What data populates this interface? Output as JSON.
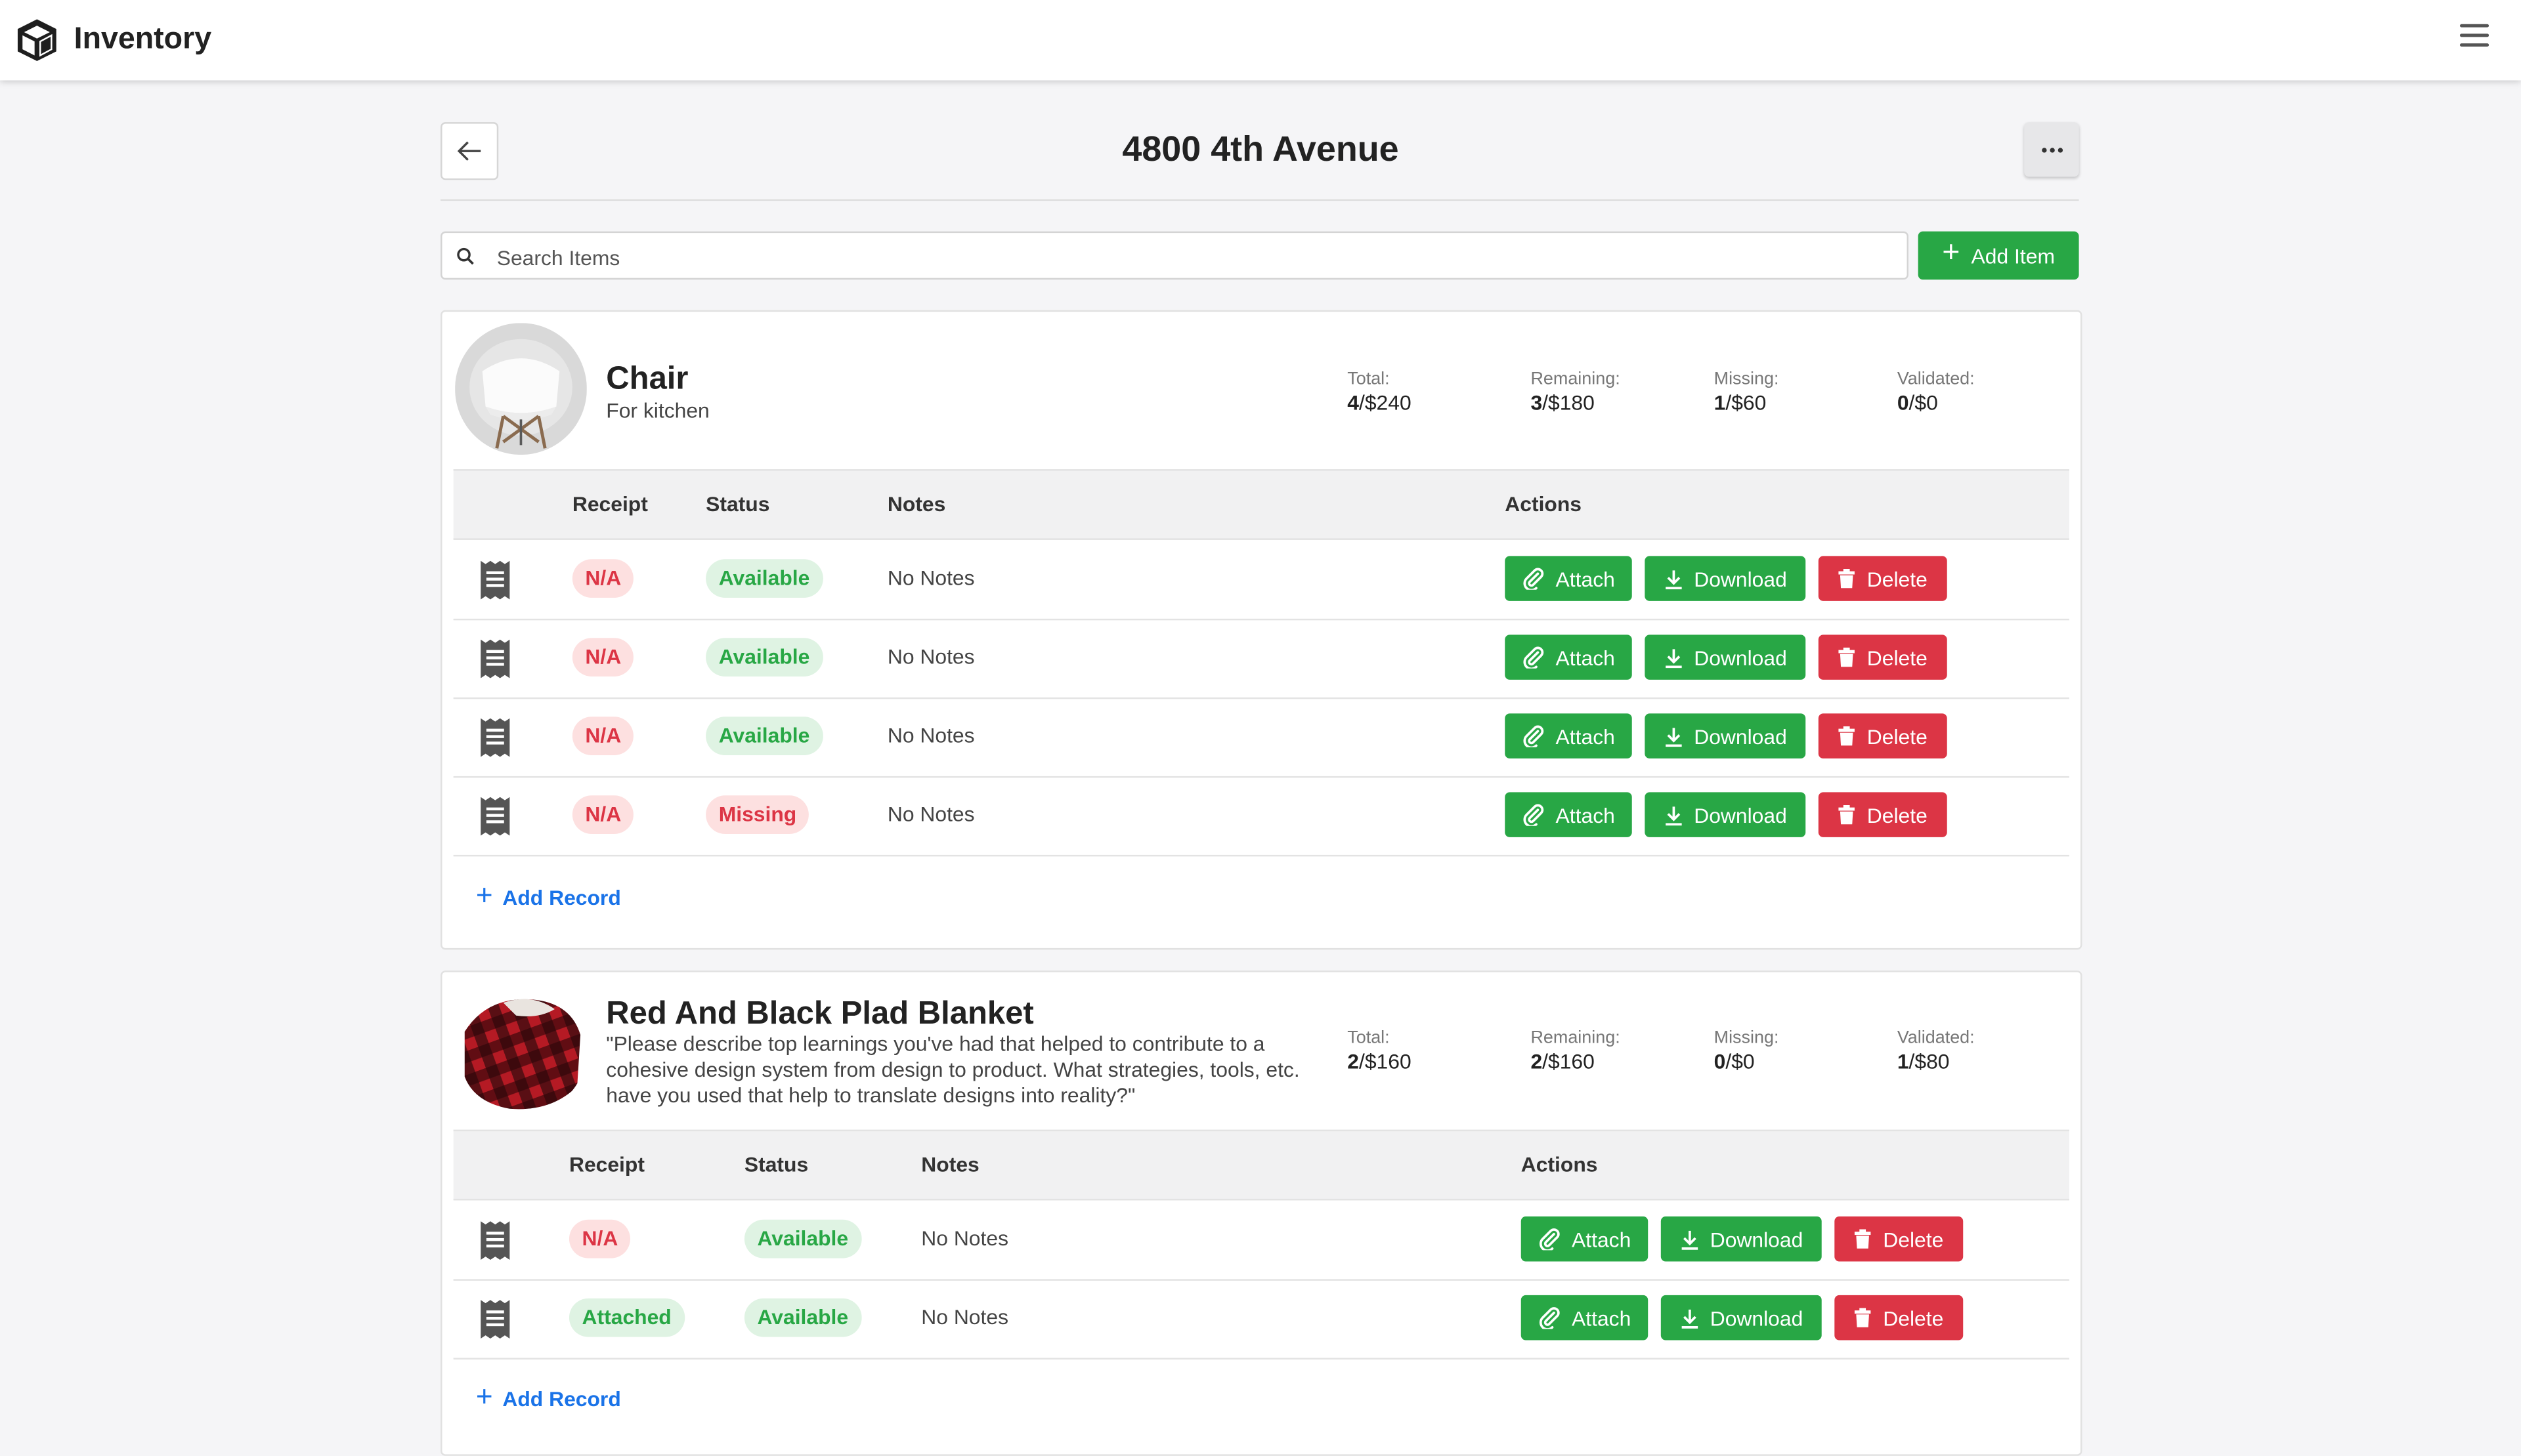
{
  "app": {
    "title": "Inventory"
  },
  "page": {
    "title": "4800 4th Avenue"
  },
  "search": {
    "placeholder": "Search Items",
    "value": ""
  },
  "toolbar": {
    "add_item_label": "Add Item"
  },
  "table_headers": {
    "receipt": "Receipt",
    "status": "Status",
    "notes": "Notes",
    "actions": "Actions"
  },
  "actions": {
    "attach": "Attach",
    "download": "Download",
    "delete": "Delete"
  },
  "add_record_label": "Add Record",
  "colors": {
    "success": "#28a745",
    "danger": "#dc3545",
    "link": "#1a73e8"
  },
  "items": [
    {
      "name": "Chair",
      "description": "For kitchen",
      "stats": {
        "total": {
          "label": "Total:",
          "value": "4/$240"
        },
        "remaining": {
          "label": "Remaining:",
          "value": "3/$180"
        },
        "missing": {
          "label": "Missing:",
          "value": "1/$60"
        },
        "validated": {
          "label": "Validated:",
          "value": "0/$0"
        }
      },
      "records": [
        {
          "receipt": "N/A",
          "status": "Available",
          "notes": "No Notes"
        },
        {
          "receipt": "N/A",
          "status": "Available",
          "notes": "No Notes"
        },
        {
          "receipt": "N/A",
          "status": "Available",
          "notes": "No Notes"
        },
        {
          "receipt": "N/A",
          "status": "Missing",
          "notes": "No Notes"
        }
      ]
    },
    {
      "name": "Red And Black Plad Blanket",
      "description": "\"Please describe top learnings you've had that helped to contribute to a cohesive design system from design to product. What strategies, tools, etc. have you used that help to translate designs into reality?\"",
      "stats": {
        "total": {
          "label": "Total:",
          "value": "2/$160"
        },
        "remaining": {
          "label": "Remaining:",
          "value": "2/$160"
        },
        "missing": {
          "label": "Missing:",
          "value": "0/$0"
        },
        "validated": {
          "label": "Validated:",
          "value": "1/$80"
        }
      },
      "records": [
        {
          "receipt": "N/A",
          "status": "Available",
          "notes": "No Notes"
        },
        {
          "receipt": "Attached",
          "status": "Available",
          "notes": "No Notes"
        }
      ]
    }
  ]
}
